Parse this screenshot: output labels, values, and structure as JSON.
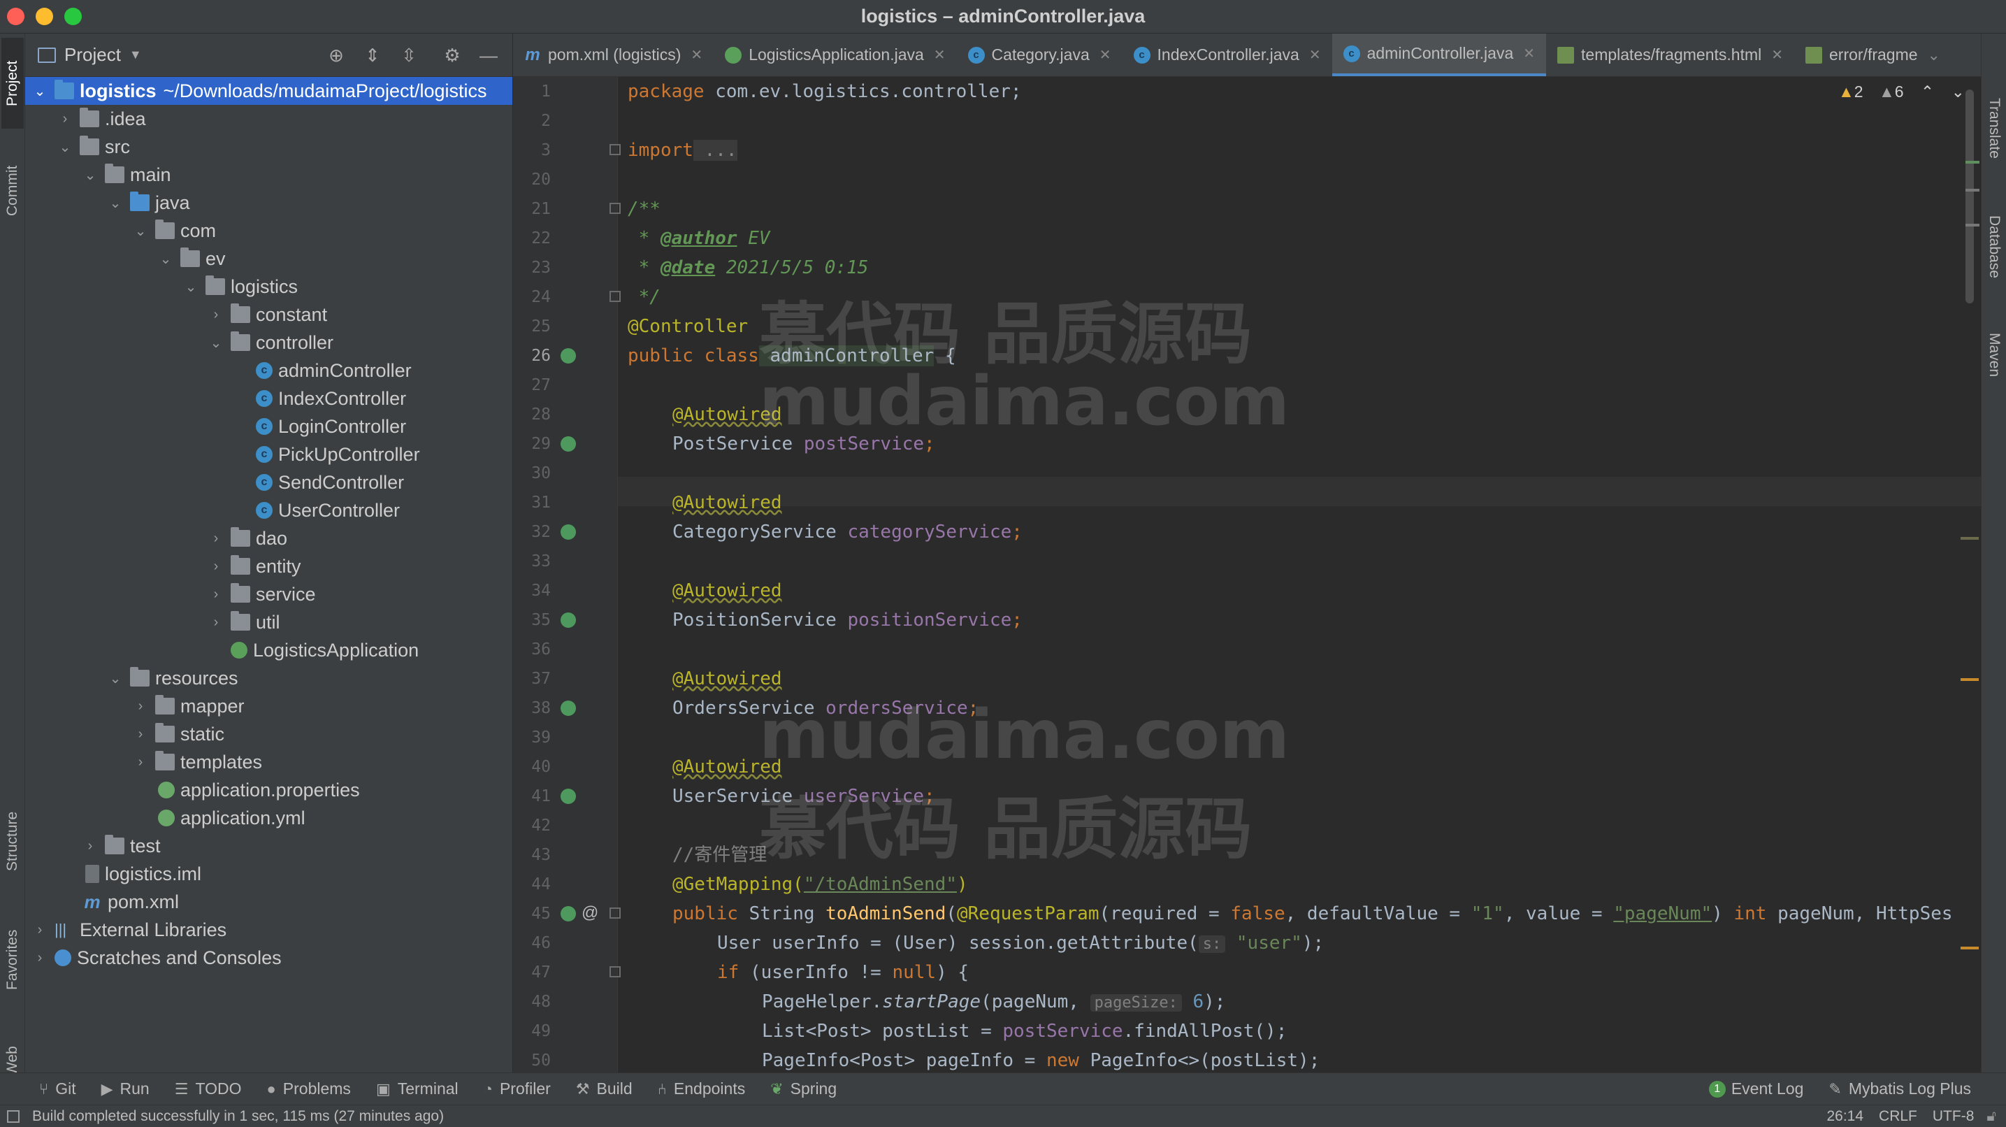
{
  "window": {
    "title": "logistics – adminController.java"
  },
  "left_tool_tabs": [
    "Project",
    "Commit",
    "Structure",
    "Favorites",
    "Web"
  ],
  "right_tool_tabs": [
    "Translate",
    "Database",
    "Maven"
  ],
  "project": {
    "header": "Project",
    "root_name": "logistics",
    "root_path": "~/Downloads/mudaimaProject/logistics",
    "tree": [
      ".idea",
      "src",
      "main",
      "java",
      "com",
      "ev",
      "logistics",
      "constant",
      "controller",
      "adminController",
      "IndexController",
      "LoginController",
      "PickUpController",
      "SendController",
      "UserController",
      "dao",
      "entity",
      "service",
      "util",
      "LogisticsApplication",
      "resources",
      "mapper",
      "static",
      "templates",
      "application.properties",
      "application.yml",
      "test",
      "logistics.iml",
      "pom.xml",
      "External Libraries",
      "Scratches and Consoles"
    ]
  },
  "tabs": [
    "pom.xml (logistics)",
    "LogisticsApplication.java",
    "Category.java",
    "IndexController.java",
    "adminController.java",
    "templates/fragments.html",
    "error/fragme"
  ],
  "editor": {
    "warnings": "2",
    "weak_warnings": "6",
    "line_numbers": [
      "1",
      "2",
      "3",
      "20",
      "21",
      "22",
      "23",
      "24",
      "25",
      "26",
      "27",
      "28",
      "29",
      "30",
      "31",
      "32",
      "33",
      "34",
      "35",
      "36",
      "37",
      "38",
      "39",
      "40",
      "41",
      "42",
      "43",
      "44",
      "45",
      "46",
      "47",
      "48",
      "49",
      "50"
    ],
    "code": {
      "l1_kw": "package",
      "l1_rest": " com.ev.logistics.controller;",
      "l3_kw": "import",
      "l3_rest": " ...",
      "l21": "/**",
      "l22_a": " * ",
      "l22_tag": "@author",
      "l22_v": " EV",
      "l23_a": " * ",
      "l23_tag": "@date",
      "l23_v": " 2021/5/5 0:15",
      "l24": " */",
      "l25": "@Controller",
      "l26_kw": "public class",
      "l26_name": " adminController",
      "l26_rest": " {",
      "autowired": "@Autowired",
      "f1_t": "PostService ",
      "f1_n": "postService",
      "semi": ";",
      "f2_t": "CategoryService ",
      "f2_n": "categoryService",
      "f3_t": "PositionService ",
      "f3_n": "positionService",
      "f4_t": "OrdersService ",
      "f4_n": "ordersService",
      "f5_t": "UserService ",
      "f5_n": "userService",
      "l43": "//寄件管理",
      "l44_a": "@GetMapping(",
      "l44_s": "\"/toAdminSend\"",
      "l44_e": ")",
      "l45_kw": "public",
      "l45_t": " String ",
      "l45_fn": "toAdminSend",
      "l45_p1": "(",
      "l45_an": "@RequestParam",
      "l45_p2": "(required = ",
      "l45_false": "false",
      "l45_p3": ", defaultValue = ",
      "l45_s1": "\"1\"",
      "l45_p4": ", value = ",
      "l45_s2": "\"pageNum\"",
      "l45_p5": ") ",
      "l45_int": "int",
      "l45_p6": " pageNum, HttpSes",
      "l46_a": "User userInfo = (User) session.getAttribute(",
      "l46_hint": "s:",
      "l46_s": " \"user\"",
      "l46_e": ");",
      "l47_kw": "if",
      "l47_a": " (userInfo != ",
      "l47_null": "null",
      "l47_e": ") {",
      "l48_a": "PageHelper.",
      "l48_m": "startPage",
      "l48_b": "(pageNum, ",
      "l48_hint": "pageSize:",
      "l48_n": " 6",
      "l48_e": ");",
      "l49_a": "List<Post> postList = ",
      "l49_f": "postService",
      "l49_e": ".findAllPost();",
      "l50_a": "PageInfo<Post> pageInfo = ",
      "l50_kw": "new",
      "l50_e": " PageInfo<>(postList);"
    }
  },
  "watermarks": [
    "慕代码 品质源码",
    "mudaima.com",
    "mudaima.com",
    "慕代码 品质源码"
  ],
  "toolwindows": [
    "Git",
    "Run",
    "TODO",
    "Problems",
    "Terminal",
    "Profiler",
    "Build",
    "Endpoints",
    "Spring"
  ],
  "toolwindows_right": {
    "event_log_count": "1",
    "event_log": "Event Log",
    "mybatis": "Mybatis Log Plus"
  },
  "status": {
    "message": "Build completed successfully in 1 sec, 115 ms (27 minutes ago)",
    "position": "26:14",
    "line_sep": "CRLF",
    "encoding": "UTF-8"
  },
  "colors": {
    "accent": "#2f65ca",
    "keyword": "#cc7832",
    "annotation": "#bbb529",
    "string": "#6a8759",
    "field": "#9876aa"
  }
}
